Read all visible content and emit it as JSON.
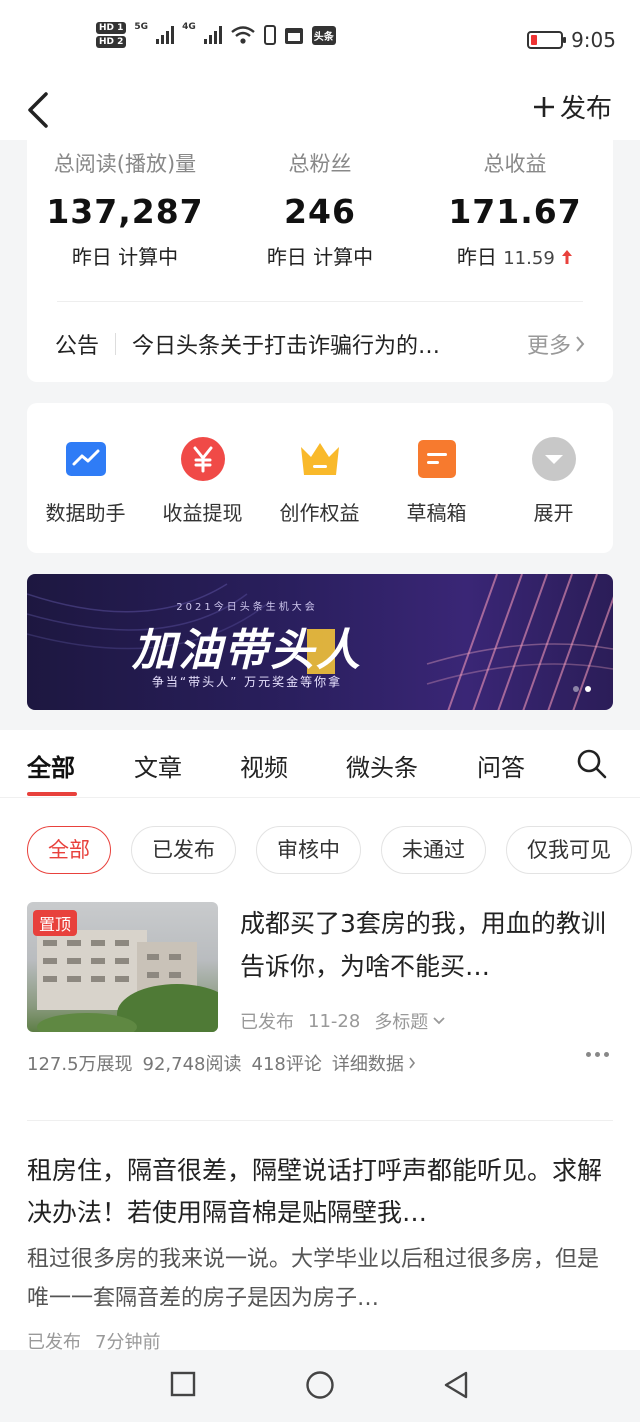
{
  "statusbar": {
    "hd1": "HD 1",
    "hd2": "HD 2",
    "net1": "5G",
    "net2": "4G",
    "app_badge": "头条",
    "time": "9:05"
  },
  "nav": {
    "publish_label": "发布"
  },
  "stats": [
    {
      "label": "总阅读(播放)量",
      "value": "137,287",
      "sub": "昨日 计算中"
    },
    {
      "label": "总粉丝",
      "value": "246",
      "sub": "昨日 计算中"
    },
    {
      "label": "总收益",
      "value": "171.67",
      "sub_prefix": "昨日",
      "sub_value": "11.59",
      "trend": "up",
      "trend_color": "#e8413c"
    }
  ],
  "notice": {
    "tag": "公告",
    "text": "今日头条关于打击诈骗行为的…",
    "more": "更多"
  },
  "tools": [
    {
      "label": "数据助手",
      "icon": "chart-icon",
      "color": "#2f7cf6"
    },
    {
      "label": "收益提现",
      "icon": "yuan-icon",
      "color": "#f04a47"
    },
    {
      "label": "创作权益",
      "icon": "crown-icon",
      "color": "#f9b92a"
    },
    {
      "label": "草稿箱",
      "icon": "draft-icon",
      "color": "#f77a2e"
    },
    {
      "label": "展开",
      "icon": "expand-icon",
      "color": "#bfbfbf"
    }
  ],
  "banner": {
    "small": "2021今日头条生机大会",
    "big": "加油带头人",
    "sub": "争当“带头人” 万元奖金等你拿",
    "page_count": 2,
    "active_page": 2
  },
  "tabs": [
    {
      "label": "全部",
      "active": true
    },
    {
      "label": "文章"
    },
    {
      "label": "视频"
    },
    {
      "label": "微头条"
    },
    {
      "label": "问答"
    }
  ],
  "filters": [
    {
      "label": "全部",
      "active": true
    },
    {
      "label": "已发布"
    },
    {
      "label": "审核中"
    },
    {
      "label": "未通过"
    },
    {
      "label": "仅我可见"
    }
  ],
  "articles": [
    {
      "pinned_label": "置顶",
      "title": "成都买了3套房的我，用血的教训告诉你，为啥不能买…",
      "status": "已发布",
      "date": "11-28",
      "multi_title": "多标题",
      "impressions": "127.5万展现",
      "reads": "92,748阅读",
      "comments": "418评论",
      "details": "详细数据"
    },
    {
      "title": "租房住，隔音很差，隔壁说话打呼声都能听见。求解决办法！若使用隔音棉是贴隔壁我…",
      "desc": "租过很多房的我来说一说。大学毕业以后租过很多房，但是唯一一套隔音差的房子是因为房子…",
      "status": "已发布",
      "time": "7分钟前"
    }
  ],
  "colors": {
    "accent": "#e8413c",
    "page_bg": "#f4f5f6"
  }
}
